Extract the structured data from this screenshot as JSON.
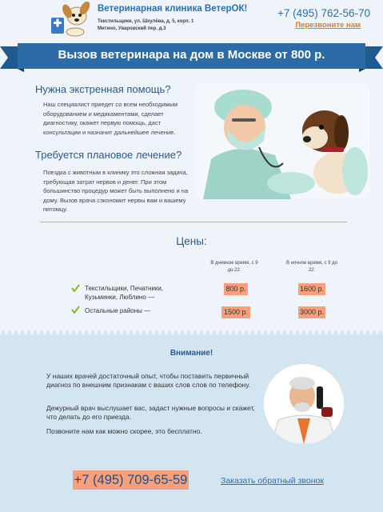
{
  "header": {
    "clinic_name": "Ветеринарная клиника ВетерОК!",
    "address_1": "Текстильщики, ул. Шкулёва, д. 5, корп. 1",
    "address_2": "Митино, Уваровский пер. д.3",
    "phone": "+7 (495) 762-56-70",
    "callback_link": "Перезвоните нам"
  },
  "banner": {
    "title": "Вызов ветеринара на дом в Москве от 800 р."
  },
  "emergency": {
    "heading": "Нужна экстренная помощь?",
    "text": "Наш специалист приедет со всем необходимым оборудованием и медикаментами, сделает диагностику, окажет первую помощь, даст консультации и назначит дальнейшее лечение."
  },
  "planned": {
    "heading": "Требуется плановое лечение?",
    "text": "Поездка с животным в клинику это сложная задача, требующая затрат нервов и денег. При этом большинство процедур может быть выполнено и на дому. Вызов врача сэкономит нервы вам и вашему питомцу."
  },
  "prices": {
    "title": "Цены:",
    "col_day": "В дневное время, с 9 до 22:",
    "col_night": "В ночное время, с 9 до 22:",
    "rows": [
      {
        "label": "Текстильщики, Печатники, Кузьминки, Люблино —",
        "day": "800 р.",
        "night": "1600 р."
      },
      {
        "label": "Остальные районы —",
        "day": "1500 р.",
        "night": "3000 р."
      }
    ]
  },
  "attention": {
    "title": "Внимание!",
    "p1": "У наших врачей достаточный опыт, чтобы поставить первичный диагноз по внешним признакам с ваших слов слов по телефону.",
    "p2": "Дежурный врач выслушает вас, задаст нужные вопросы и скажет, что делать до его приезда.",
    "p3": "Позвоните нам как можно скорее, это бесплатно."
  },
  "footer": {
    "phone": "+7 (495) 709-65-59",
    "callback_link": "Заказать обратный звонок"
  },
  "colors": {
    "accent": "#2a6fb5",
    "ribbon": "#2d6ba6",
    "price_bg": "#f9a07a",
    "link_orange": "#e07a22"
  }
}
